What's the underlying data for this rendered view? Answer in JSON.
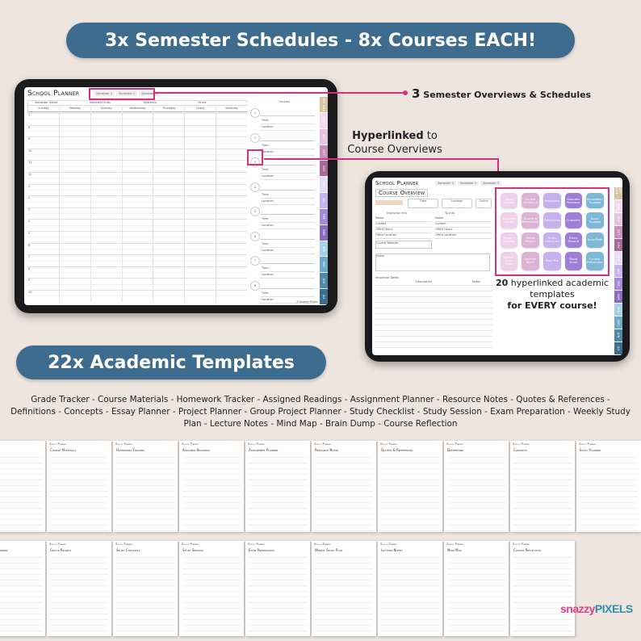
{
  "banner_top": "3x Semester Schedules - 8x Courses EACH!",
  "banner_templates": "22x Academic Templates",
  "annotations": {
    "semesters_num": "3",
    "semesters_text": "Semester Overviews & Schedules",
    "hyperlinked_bold": "Hyperlinked",
    "hyperlinked_rest": " to",
    "hyperlinked_line2": "Course Overviews",
    "caption_num": "20",
    "caption_mid": " hyperlinked academic templates",
    "caption_bold": "for EVERY course!"
  },
  "planner": {
    "title": "School Planner",
    "semester_tabs": [
      "Semester 1",
      "Semester 2",
      "Semester 3"
    ],
    "info_fields": [
      "Semester Starts",
      "Semester Ends",
      "Midterms",
      "Finals"
    ],
    "days": [
      "Sunday",
      "Monday",
      "Tuesday",
      "Wednesday",
      "Thursday",
      "Friday",
      "Saturday"
    ],
    "hours": [
      "7",
      "8",
      "9",
      "10",
      "11",
      "12",
      "1",
      "2",
      "3",
      "4",
      "5",
      "6",
      "7",
      "8",
      "9",
      "10"
    ],
    "courses_header": "Courses",
    "course_numbers": [
      "1",
      "2",
      "3",
      "4",
      "5",
      "6",
      "7",
      "8"
    ],
    "course_fields": [
      "Time",
      "Location"
    ],
    "side_tabs": [
      {
        "label": "SEM ###",
        "color": "#d9c3a5"
      },
      {
        "label": "AUG",
        "color": "#f1d9ee"
      },
      {
        "label": "SEP",
        "color": "#e6c3df"
      },
      {
        "label": "OCT",
        "color": "#c98fbb"
      },
      {
        "label": "NOV",
        "color": "#a9679c"
      },
      {
        "label": "DEC",
        "color": "#e6dcf6"
      },
      {
        "label": "JAN",
        "color": "#c7b4ee"
      },
      {
        "label": "FEB",
        "color": "#a58ad9"
      },
      {
        "label": "MAR",
        "color": "#8a6cc3"
      },
      {
        "label": "APR",
        "color": "#a7d2e6"
      },
      {
        "label": "MAY",
        "color": "#6ea9c8"
      },
      {
        "label": "JUN",
        "color": "#4f8aa8"
      },
      {
        "label": "JUL",
        "color": "#3e6c8c"
      }
    ],
    "footer": "©Snazzy Pixels"
  },
  "overview": {
    "title": "Course Overview",
    "fields": [
      "Time",
      "Location",
      "Online"
    ],
    "instructor_header": "Instructor Info",
    "ta_header": "TA Info",
    "info_rows": [
      "Name",
      "Contact",
      "Office Hours",
      "Office Location"
    ],
    "website": "Course Website",
    "notes": "Notes",
    "important_dates": "Important Dates",
    "dates_cols": [
      "Description",
      "Notes"
    ],
    "tiles": [
      "Grade Tracker",
      "Course Materials",
      "Homework",
      "Assigned Readings",
      "Assignment Planner",
      "Resource Notes",
      "Quotes & References",
      "Definitions",
      "Concepts",
      "Essay Planner",
      "Project Planner",
      "Group Project",
      "Study Checklist",
      "Study Session",
      "Exam Prep",
      "Weekly Study Plan",
      "Lecture Notes",
      "Mind Map",
      "Brain Dump",
      "Course Reflection"
    ],
    "tile_colors": [
      "#eed1e8",
      "#dbb3d4",
      "#c6b1ee",
      "#9d80d6",
      "#7fb7d6"
    ]
  },
  "template_list": "Grade Tracker - Course Materials - Homework Tracker - Assigned Readings - Assignment Planner - Resource Notes - Quotes & References - Definitions - Concepts - Essay Planner - Project Planner - Group Project Planner - Study Checklist - Study Session - Exam Preparation - Weekly Study Plan - Lecture Notes - Mind Map - Brain Dump - Course Reflection",
  "thumbnails": {
    "header": "School Planner",
    "row1": [
      "",
      "Course Materials",
      "Homework Tracker",
      "Assigned Readings",
      "Assignment Planner",
      "Resource Notes",
      "Quotes & References",
      "Definitions",
      "Concepts",
      "Essay Planner"
    ],
    "row2": [
      "Project Planner",
      "Group Project",
      "Study Checklist",
      "Study Session",
      "Exam Preparation",
      "Weekly Study Plan",
      "Lecture Notes",
      "Mind Map",
      "Course Reflection"
    ]
  },
  "logo": {
    "part1": "snazzy",
    "part2": "PIXELS",
    "color1": "#e0408a",
    "color2": "#2f8fb0"
  },
  "colors": {
    "banner": "#3e6c8f",
    "highlight": "#d6307f",
    "background": "#efe5df"
  }
}
